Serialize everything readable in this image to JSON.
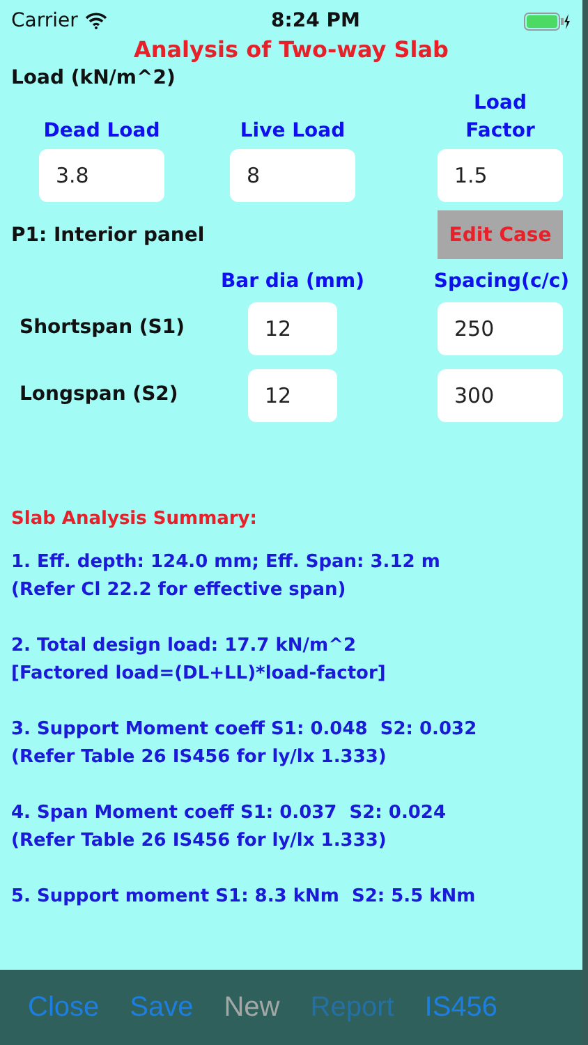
{
  "status_bar": {
    "carrier": "Carrier",
    "time": "8:24 PM"
  },
  "title": "Analysis of Two-way Slab",
  "load_section": {
    "label": "Load (kN/m^2)",
    "fields": [
      {
        "label": "Dead Load",
        "value": "3.8"
      },
      {
        "label": "Live Load",
        "value": "8"
      },
      {
        "label": "Load Factor",
        "value": "1.5"
      }
    ]
  },
  "panel": {
    "label": "P1: Interior panel",
    "edit_button": "Edit Case"
  },
  "reinforcement": {
    "columns": [
      "Bar dia (mm)",
      "Spacing(c/c)"
    ],
    "rows": [
      {
        "label": "Shortspan (S1)",
        "bar_dia": "12",
        "spacing": "250"
      },
      {
        "label": "Longspan (S2)",
        "bar_dia": "12",
        "spacing": "300"
      }
    ]
  },
  "summary": {
    "title": "Slab Analysis Summary:",
    "items": [
      [
        "1. Eff. depth: 124.0 mm; Eff. Span: 3.12 m",
        "(Refer Cl 22.2 for effective span)"
      ],
      [
        "2. Total design load: 17.7 kN/m^2",
        "[Factored load=(DL+LL)*load-factor]"
      ],
      [
        "3. Support Moment coeff S1: 0.048  S2: 0.032",
        "(Refer Table 26 IS456 for ly/lx 1.333)"
      ],
      [
        "4. Span Moment coeff S1: 0.037  S2: 0.024",
        "(Refer Table 26 IS456 for ly/lx 1.333)"
      ],
      [
        "5. Support moment S1: 8.3 kNm  S2: 5.5 kNm"
      ]
    ]
  },
  "toolbar": [
    {
      "label": "Close",
      "kind": "link",
      "disabled": false
    },
    {
      "label": "Save",
      "kind": "link",
      "disabled": false
    },
    {
      "label": "New",
      "kind": "neutral",
      "disabled": false
    },
    {
      "label": "Report",
      "kind": "link",
      "disabled": true
    },
    {
      "label": "IS456",
      "kind": "link",
      "disabled": false
    }
  ]
}
